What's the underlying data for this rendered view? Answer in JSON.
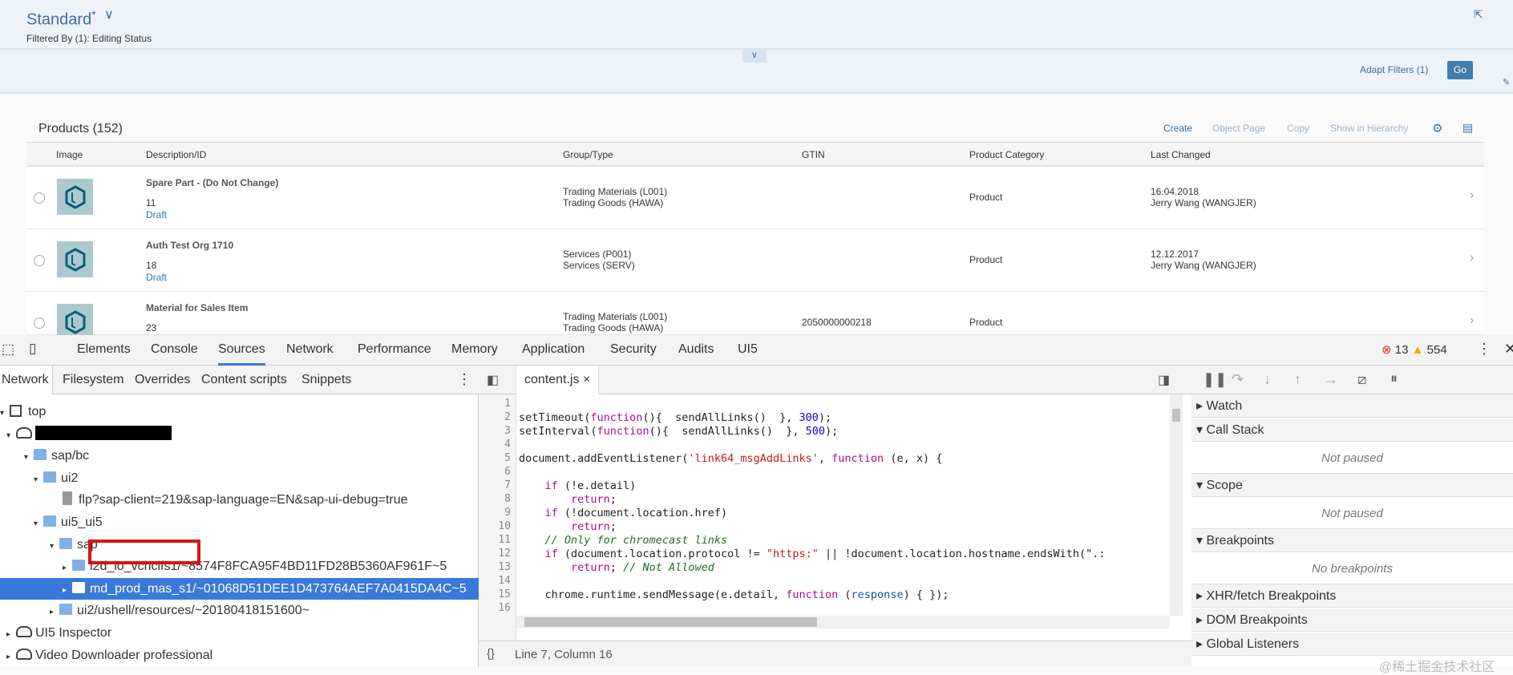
{
  "header": {
    "variant": "Standard",
    "dirty_mark": "*",
    "filtered_by": "Filtered By (1): Editing Status",
    "adapt_filters": "Adapt Filters (1)",
    "go": "Go"
  },
  "table": {
    "title": "Products (152)",
    "actions": [
      "Create",
      "Object Page",
      "Copy",
      "Show in Hierarchy"
    ],
    "columns": [
      "Image",
      "Description/ID",
      "Group/Type",
      "GTIN",
      "Product Category",
      "Last Changed"
    ],
    "rows": [
      {
        "desc": "Spare Part - (Do Not Change)",
        "id": "11",
        "status": "Draft",
        "group": "Trading Materials (L001)",
        "type": "Trading Goods (HAWA)",
        "gtin": "",
        "category": "Product",
        "date": "16.04.2018",
        "user": "Jerry Wang (WANGJER)"
      },
      {
        "desc": "Auth Test Org 1710",
        "id": "18",
        "status": "Draft",
        "group": "Services (P001)",
        "type": "Services (SERV)",
        "gtin": "",
        "category": "Product",
        "date": "12.12.2017",
        "user": "Jerry Wang (WANGJER)"
      },
      {
        "desc": "Material for Sales Item",
        "id": "23",
        "status": "",
        "group": "Trading Materials (L001)",
        "type": "Trading Goods (HAWA)",
        "gtin": "2050000000218",
        "category": "Product",
        "date": "",
        "user": ""
      }
    ]
  },
  "devtools": {
    "tabs": [
      "Elements",
      "Console",
      "Sources",
      "Network",
      "Performance",
      "Memory",
      "Application",
      "Security",
      "Audits",
      "UI5"
    ],
    "errors": "13",
    "warnings": "554",
    "subtabs": [
      "Network",
      "Filesystem",
      "Overrides",
      "Content scripts",
      "Snippets"
    ],
    "tree": [
      "top",
      "sap/bc",
      "ui2",
      "flp?sap-client=219&sap-language=EN&sap-ui-debug=true",
      "ui5_ui5",
      "sap",
      "i2d_lo_vchclfs1/~8574F8FCA95F4BD11FD28B5360AF961F~5",
      "md_prod_mas_s1/~01068D51DEE1D473764AEF7A0415DA4C~5",
      "ui2/ushell/resources/~20180418151600~",
      "UI5 Inspector",
      "Video Downloader professional"
    ],
    "file_tab": "content.js",
    "code": [
      [],
      [
        [
          "",
          "setTimeout("
        ],
        [
          "k",
          "function"
        ],
        [
          "",
          "(){  sendAllLinks()  }, "
        ],
        [
          "n",
          "300"
        ],
        [
          "",
          ");"
        ]
      ],
      [
        [
          "",
          "setInterval("
        ],
        [
          "k",
          "function"
        ],
        [
          "",
          "(){  sendAllLinks()  }, "
        ],
        [
          "n",
          "500"
        ],
        [
          "",
          ");"
        ]
      ],
      [],
      [
        [
          "",
          "document.addEventListener("
        ],
        [
          "s",
          "'link64_msgAddLinks'"
        ],
        [
          "",
          ", "
        ],
        [
          "k",
          "function"
        ],
        [
          "",
          " (e, x) {"
        ]
      ],
      [],
      [
        [
          "",
          "    "
        ],
        [
          "k",
          "if"
        ],
        [
          "",
          " (!e.detail)"
        ]
      ],
      [
        [
          "",
          "        "
        ],
        [
          "k",
          "return"
        ],
        [
          "",
          ";"
        ]
      ],
      [
        [
          "",
          "    "
        ],
        [
          "k",
          "if"
        ],
        [
          "",
          " (!document.location.href)"
        ]
      ],
      [
        [
          "",
          "        "
        ],
        [
          "k",
          "return"
        ],
        [
          "",
          ";"
        ]
      ],
      [
        [
          "",
          "    "
        ],
        [
          "c",
          "// Only for chromecast links"
        ]
      ],
      [
        [
          "",
          "    "
        ],
        [
          "k",
          "if"
        ],
        [
          "",
          " (document.location.protocol != "
        ],
        [
          "s",
          "\"https:\""
        ],
        [
          "",
          " || !document.location.hostname.endsWith(\".:"
        ]
      ],
      [
        [
          "",
          "        "
        ],
        [
          "k",
          "return"
        ],
        [
          "",
          "; "
        ],
        [
          "c",
          "// Not Allowed"
        ]
      ],
      [],
      [
        [
          "",
          "    chrome.runtime.sendMessage(e.detail, "
        ],
        [
          "k",
          "function"
        ],
        [
          "",
          " ("
        ],
        [
          "v",
          "response"
        ],
        [
          "",
          ") { });"
        ]
      ],
      []
    ],
    "status": "Line 7, Column 16",
    "sections": {
      "watch": "Watch",
      "call_stack": "Call Stack",
      "not_paused": "Not paused",
      "scope": "Scope",
      "breakpoints": "Breakpoints",
      "no_breakpoints": "No breakpoints",
      "xhr": "XHR/fetch Breakpoints",
      "dom": "DOM Breakpoints",
      "global": "Global Listeners"
    }
  },
  "watermark": "@稀土掘金技术社区"
}
